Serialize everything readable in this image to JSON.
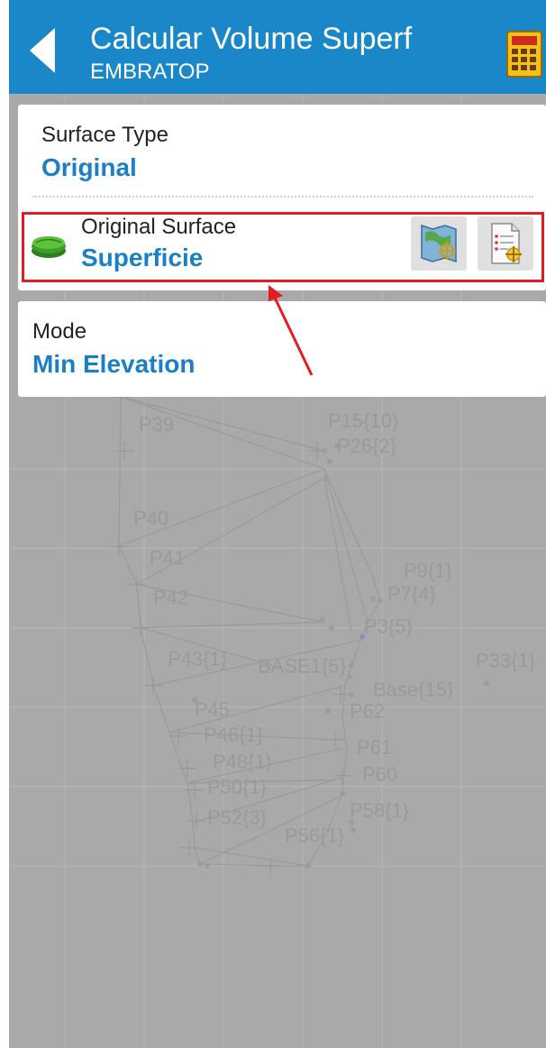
{
  "header": {
    "title": "Calcular Volume Superf",
    "subtitle": "EMBRATOP"
  },
  "surface_type": {
    "label": "Surface Type",
    "value": "Original"
  },
  "original_surface": {
    "label": "Original Surface",
    "value": "Superficie"
  },
  "mode": {
    "label": "Mode",
    "value": "Min Elevation"
  },
  "map_labels": [
    "P39",
    "P15{10}",
    "P26{2}",
    "P40",
    "P41",
    "P9{1}",
    "P7{4}",
    "P42",
    "P3{5}",
    "P43{1}",
    "BASE1{5}",
    "P33{1}",
    "Base{15}",
    "P45",
    "P62",
    "P46{1}",
    "P61",
    "P48{1}",
    "P60",
    "P50{1}",
    "P58{1}",
    "P52{3}",
    "P56{1}"
  ],
  "colors": {
    "header": "#1a87c9",
    "accent_text": "#1a7fc4",
    "highlight": "#e31b23",
    "map_background": "#a9a9a9"
  },
  "icons": {
    "back": "back-arrow-icon",
    "calculator": "calculator-icon",
    "surface": "surface-layers-icon",
    "map_select": "map-select-icon",
    "list_select": "list-select-icon",
    "annotation": "red-arrow-icon"
  }
}
